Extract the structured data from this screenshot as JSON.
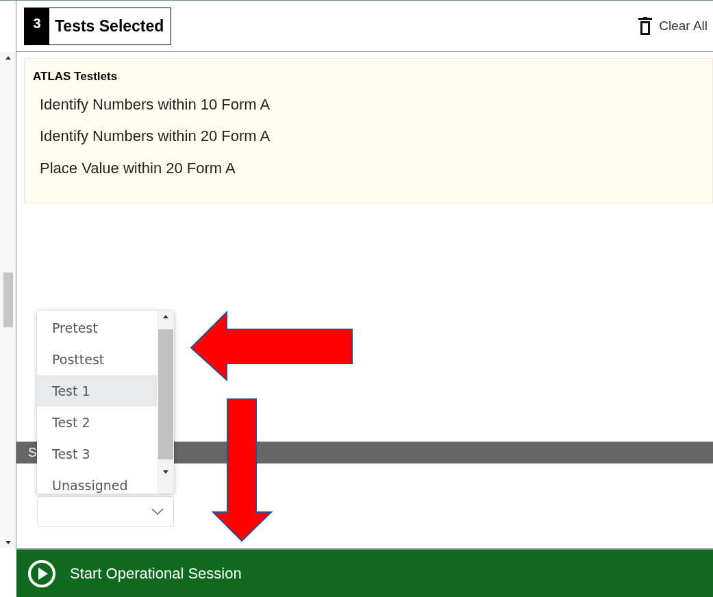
{
  "header": {
    "count": "3",
    "label": "Tests Selected",
    "clear_button": "Clear All"
  },
  "testlets": {
    "title": "ATLAS Testlets",
    "items": [
      "Identify Numbers within 10 Form A",
      "Identify Numbers within 20 Form A",
      "Place Value within 20 Form A"
    ]
  },
  "section_bar": {
    "label": "S"
  },
  "dropdown": {
    "expanded": true,
    "options": [
      {
        "label": "Pretest",
        "selected": false
      },
      {
        "label": "Posttest",
        "selected": false
      },
      {
        "label": "Test 1",
        "selected": true
      },
      {
        "label": "Test 2",
        "selected": false
      },
      {
        "label": "Test 3",
        "selected": false
      },
      {
        "label": "Unassigned",
        "selected": false
      }
    ]
  },
  "start_button": {
    "label": "Start Operational Session"
  }
}
